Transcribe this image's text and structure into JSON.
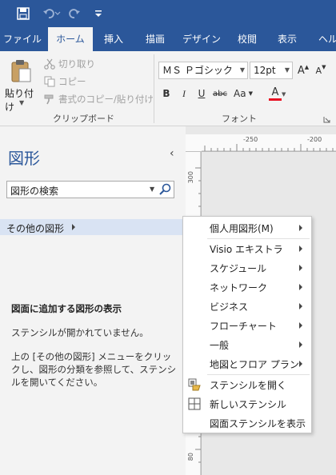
{
  "quick_access": {
    "save_icon": "save-icon",
    "undo_icon": "undo-icon",
    "redo_icon": "redo-icon",
    "customize_icon": "customize-qat-icon"
  },
  "tabs": [
    {
      "label": "ファイル",
      "active": false
    },
    {
      "label": "ホーム",
      "active": true
    },
    {
      "label": "挿入",
      "active": false
    },
    {
      "label": "描画",
      "active": false
    },
    {
      "label": "デザイン",
      "active": false
    },
    {
      "label": "校閲",
      "active": false
    },
    {
      "label": "表示",
      "active": false
    },
    {
      "label": "ヘル",
      "active": false
    }
  ],
  "clipboard": {
    "paste_label": "貼り付け",
    "cut_label": "切り取り",
    "copy_label": "コピー",
    "format_painter_label": "書式のコピー/貼り付け",
    "group_label": "クリップボード"
  },
  "font": {
    "font_name": "ＭＳ Ｐゴシック",
    "font_size": "12pt",
    "grow_label": "A",
    "shrink_label": "A",
    "bold_label": "B",
    "italic_label": "I",
    "underline_label": "U",
    "strike_label": "abc",
    "case_label": "Aa",
    "color_label": "A",
    "font_color": "#e81123",
    "group_label": "フォント"
  },
  "shapes_pane": {
    "title": "図形",
    "search_placeholder": "図形の検索",
    "more_shapes_label": "その他の図形",
    "help_title": "図面に追加する図形の表示",
    "help_line1": "ステンシルが開かれていません。",
    "help_line2": "上の [その他の図形] メニューをクリックし、図形の分類を参照して、ステンシルを開いてください。"
  },
  "ruler": {
    "h_labels": [
      "-250",
      "-200"
    ],
    "v_labels": [
      "300",
      "80"
    ]
  },
  "context_menu": {
    "items": [
      {
        "label": "個人用図形(M)",
        "submenu": true,
        "icon": ""
      },
      {
        "label": "Visio エキストラ",
        "submenu": true,
        "icon": ""
      },
      {
        "label": "スケジュール",
        "submenu": true,
        "icon": ""
      },
      {
        "label": "ネットワーク",
        "submenu": true,
        "icon": ""
      },
      {
        "label": "ビジネス",
        "submenu": true,
        "icon": ""
      },
      {
        "label": "フローチャート",
        "submenu": true,
        "icon": ""
      },
      {
        "label": "一般",
        "submenu": true,
        "icon": ""
      },
      {
        "label": "地図とフロア プラン",
        "submenu": true,
        "icon": ""
      },
      {
        "label": "ステンシルを開く",
        "submenu": false,
        "icon": "open-stencil-icon"
      },
      {
        "label": "新しいステンシル",
        "submenu": false,
        "icon": "new-stencil-icon"
      },
      {
        "label": "図面ステンシルを表示",
        "submenu": false,
        "icon": ""
      }
    ]
  },
  "colors": {
    "accent": "#2b579a",
    "selected_bg": "#d9e3f3"
  }
}
